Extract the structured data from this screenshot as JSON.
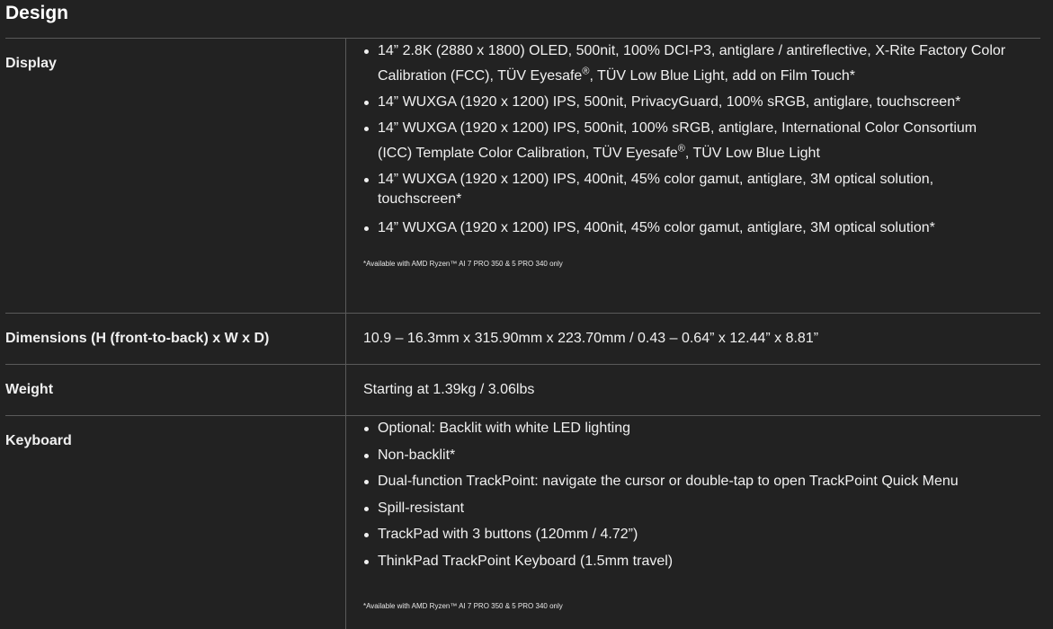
{
  "section": {
    "title": "Design"
  },
  "rows": {
    "display": {
      "label": "Display",
      "items": [
        {
          "line1": "14” 2.8K (2880 x 1800) OLED, 500nit, 100% DCI-P3, antiglare / antireflective, X-Rite Factory Color",
          "line2_pre": "Calibration (FCC), TÜV Eyesafe",
          "line2_sup": "®",
          "line2_post": ", TÜV Low Blue Light, add on Film Touch*"
        },
        {
          "text": "14” WUXGA (1920 x 1200) IPS, 500nit, PrivacyGuard, 100% sRGB, antiglare, touchscreen*"
        },
        {
          "line1": "14” WUXGA (1920 x 1200) IPS, 500nit, 100% sRGB, antiglare, International Color Consortium",
          "line2_pre": "(ICC) Template Color Calibration, TÜV Eyesafe",
          "line2_sup": "®",
          "line2_post": ", TÜV Low Blue Light"
        },
        {
          "line1": "14” WUXGA (1920 x 1200) IPS, 400nit, 45% color gamut, antiglare, 3M optical solution,",
          "line2": "touchscreen*"
        },
        {
          "text": "14” WUXGA (1920 x 1200) IPS, 400nit, 45% color gamut, antiglare, 3M optical solution*"
        }
      ],
      "footnote": "*Available with AMD Ryzen™ AI 7 PRO 350 & 5 PRO 340 only"
    },
    "dimensions": {
      "label": "Dimensions (H (front-to-back) x W x D)",
      "value": "10.9 – 16.3mm x 315.90mm x 223.70mm / 0.43 – 0.64” x 12.44” x 8.81”"
    },
    "weight": {
      "label": "Weight",
      "value": "Starting at 1.39kg / 3.06lbs"
    },
    "keyboard": {
      "label": "Keyboard",
      "items": [
        "Optional: Backlit with white LED lighting",
        "Non-backlit*",
        "Dual-function TrackPoint: navigate the cursor or double-tap to open TrackPoint Quick Menu",
        "Spill-resistant",
        "TrackPad with 3 buttons (120mm / 4.72”)",
        "ThinkPad TrackPoint Keyboard (1.5mm travel)"
      ],
      "footnote": "*Available with AMD Ryzen™ AI 7 PRO 350 & 5 PRO 340 only"
    }
  }
}
